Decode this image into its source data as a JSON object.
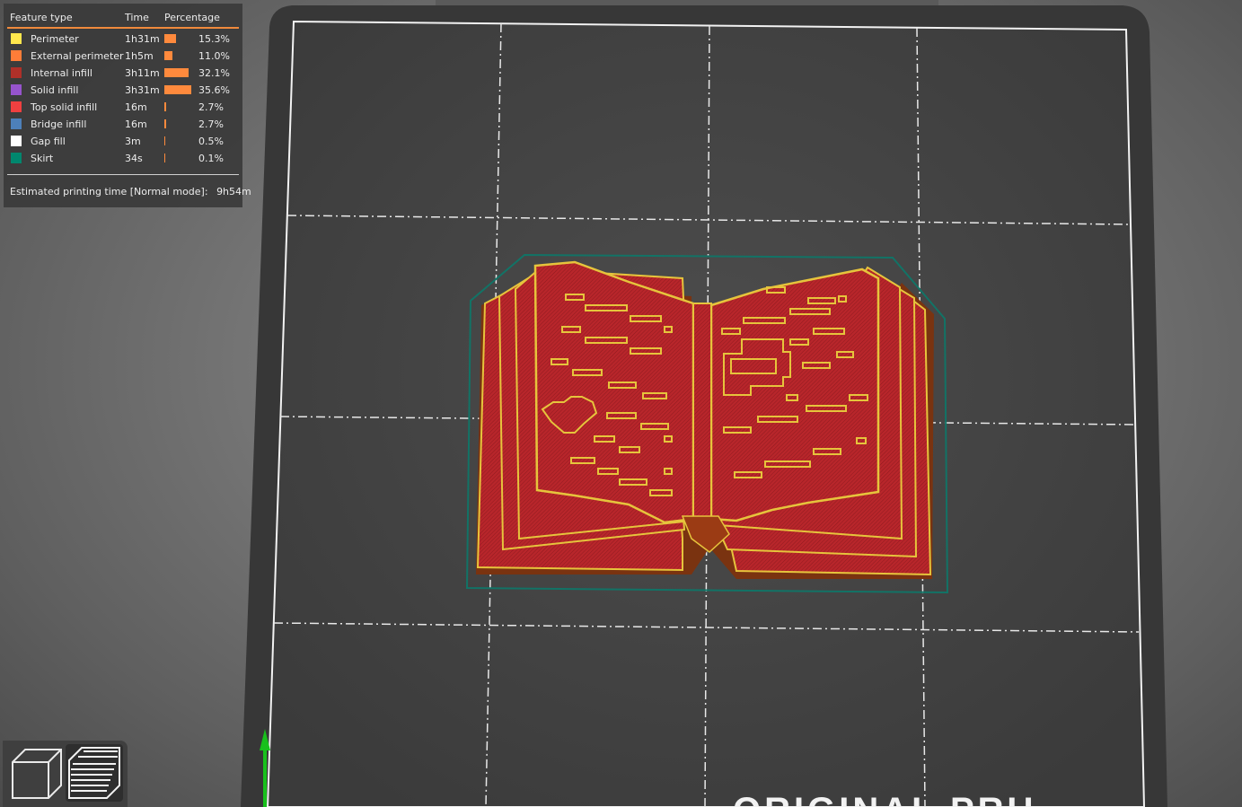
{
  "legend": {
    "headers": {
      "feature": "Feature type",
      "time": "Time",
      "percentage": "Percentage"
    },
    "items": [
      {
        "label": "Perimeter",
        "time": "1h31m",
        "percent": "15.3%",
        "value": 15.3,
        "color": "#ffe74d"
      },
      {
        "label": "External perimeter",
        "time": "1h5m",
        "percent": "11.0%",
        "value": 11.0,
        "color": "#ff7d38"
      },
      {
        "label": "Internal infill",
        "time": "3h11m",
        "percent": "32.1%",
        "value": 32.1,
        "color": "#b03029"
      },
      {
        "label": "Solid infill",
        "time": "3h31m",
        "percent": "35.6%",
        "value": 35.6,
        "color": "#9654cc"
      },
      {
        "label": "Top solid infill",
        "time": "16m",
        "percent": "2.7%",
        "value": 2.7,
        "color": "#f04040"
      },
      {
        "label": "Bridge infill",
        "time": "16m",
        "percent": "2.7%",
        "value": 2.7,
        "color": "#4d80ba"
      },
      {
        "label": "Gap fill",
        "time": "3m",
        "percent": "0.5%",
        "value": 0.5,
        "color": "#ffffff"
      },
      {
        "label": "Skirt",
        "time": "34s",
        "percent": "0.1%",
        "value": 0.1,
        "color": "#00876e"
      }
    ],
    "estimate_label": "Estimated printing time [Normal mode]:",
    "estimate_value": "9h54m",
    "bar_color": "#ff8a3d"
  },
  "bed": {
    "bottom_text": "ORIGINAL PRU",
    "plate_color": "#383838",
    "surface_color": "#454545"
  },
  "print": {
    "infill_color": "#b8262b",
    "perimeter_color": "#e6c43c",
    "skirt_color": "#127366"
  },
  "view_toggle": {
    "buttons": [
      {
        "name": "3d-view",
        "icon": "cube-icon"
      },
      {
        "name": "preview",
        "icon": "layers-icon"
      }
    ]
  }
}
